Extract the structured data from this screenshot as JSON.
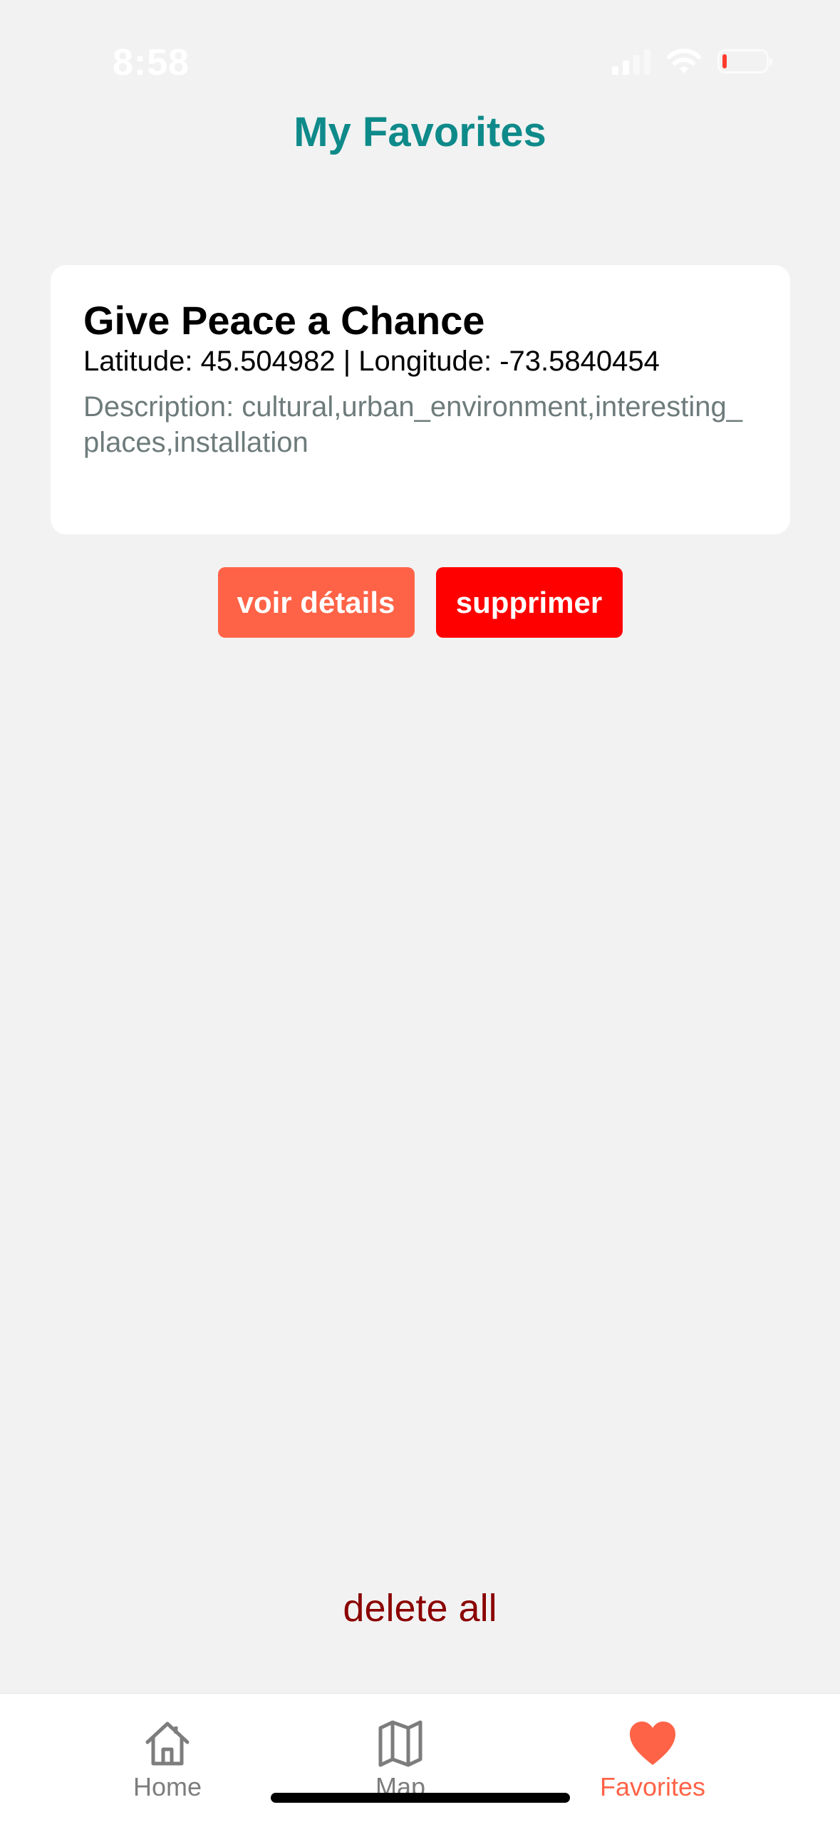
{
  "status_bar": {
    "time": "8:58",
    "battery_level_percent": 5,
    "battery_color": "#ff3b30"
  },
  "header": {
    "title": "My Favorites",
    "title_color": "#0f8a8a"
  },
  "favorites": [
    {
      "name": "Give Peace a Chance",
      "coordinates": "Latitude: 45.504982 | Longitude: -73.5840454",
      "description": "Description: cultural,urban_environment,interesting_places,installation"
    }
  ],
  "actions": {
    "details_label": "voir détails",
    "details_color": "#ff6347",
    "delete_label": "supprimer",
    "delete_color": "#ff0000"
  },
  "footer": {
    "delete_all_label": "delete all",
    "delete_all_color": "#8b0000"
  },
  "tab_bar": {
    "tabs": [
      {
        "label": "Home",
        "icon": "home-icon",
        "active": false
      },
      {
        "label": "Map",
        "icon": "map-icon",
        "active": false
      },
      {
        "label": "Favorites",
        "icon": "heart-icon",
        "active": true
      }
    ],
    "active_color": "#ff6347",
    "inactive_color": "#7d7d7d"
  }
}
